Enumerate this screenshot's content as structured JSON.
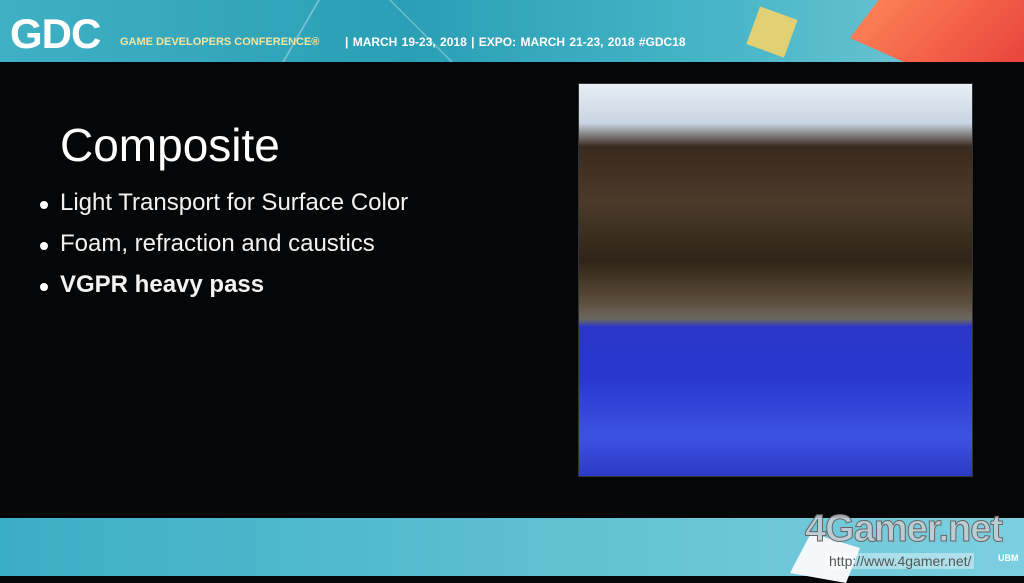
{
  "header": {
    "logo": "GDC",
    "conference": "GAME DEVELOPERS CONFERENCE®",
    "dates": "| MARCH 19-23, 2018 | EXPO: MARCH 21-23, 2018 #GDC18"
  },
  "slide": {
    "title": "Composite",
    "bullets": [
      {
        "text": "Light Transport for Surface Color",
        "bold": false
      },
      {
        "text": "Foam, refraction and caustics",
        "bold": false
      },
      {
        "text": "VGPR heavy pass",
        "bold": true
      }
    ]
  },
  "watermark": {
    "brand": "4Gamer.net",
    "url": "http://www.4gamer.net/",
    "ubm": "UBM"
  }
}
